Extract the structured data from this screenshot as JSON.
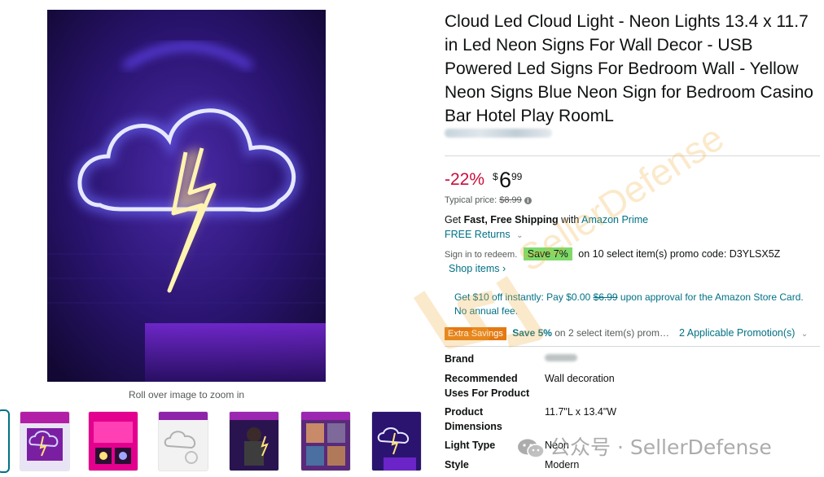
{
  "product": {
    "title": "Cloud Led Cloud Light - Neon Lights 13.4 x 11.7 in Led Neon Signs For Wall Decor - USB Powered Led Signs For Bedroom Wall - Yellow Neon Signs Blue Neon Sign for Bedroom Casino Bar Hotel Play RoomL"
  },
  "gallery": {
    "zoom_hint": "Roll over image to zoom in",
    "thumb_count": 7
  },
  "pricing": {
    "discount": "-22%",
    "currency": "$",
    "whole": "6",
    "fraction": "99",
    "typical_label": "Typical price:",
    "typical_price": "$8.99"
  },
  "shipping": {
    "get": "Get ",
    "fast": "Fast, Free Shipping",
    "with": " with ",
    "prime": "Amazon Prime",
    "returns": "FREE Returns",
    "returns_chevron": "⌄"
  },
  "promo": {
    "sign_in": "Sign in to redeem.",
    "badge": "Save 7%",
    "text": "on 10 select item(s) promo code: D3YLSX5Z",
    "shop_items": "Shop items ›"
  },
  "card_offer": {
    "part1": "Get $10 off instantly: Pay $0.00 ",
    "strike": "$6.99",
    "part2": " upon approval for the Amazon Store Card. No annual fee."
  },
  "extra": {
    "badge": "Extra Savings",
    "save": "Save 5%",
    "text": " on 2 select item(s) prom…",
    "applicable": "2 Applicable Promotion(s)",
    "chevron": "⌄"
  },
  "specs": {
    "brand_label": "Brand",
    "uses_label": "Recommended Uses For Product",
    "uses_value": "Wall decoration",
    "dims_label": "Product Dimensions",
    "dims_value": "11.7\"L x 13.4\"W",
    "light_label": "Light Type",
    "light_value": "Neon",
    "style_label": "Style",
    "style_value": "Modern"
  },
  "watermark": {
    "diagonal": "SellerDefense",
    "wechat": "公众号 · SellerDefense"
  },
  "colors": {
    "link": "#007185",
    "discount": "#cc0c39",
    "promo_green": "#7fda69",
    "extra_orange": "#e47911"
  }
}
